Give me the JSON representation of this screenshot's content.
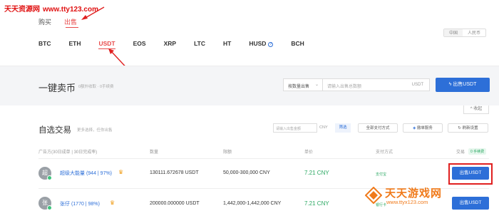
{
  "watermark": {
    "site_name": "天天资源网",
    "url": "www.tty123.com"
  },
  "trade_tabs": [
    {
      "label": "购买",
      "active": false
    },
    {
      "label": "出售",
      "active": true
    }
  ],
  "currency_toggle": [
    {
      "label": "中国",
      "active": true
    },
    {
      "label": "人民币",
      "active": false
    }
  ],
  "coins": [
    {
      "label": "BTC",
      "active": false
    },
    {
      "label": "ETH",
      "active": false
    },
    {
      "label": "USDT",
      "active": true
    },
    {
      "label": "EOS",
      "active": false
    },
    {
      "label": "XRP",
      "active": false
    },
    {
      "label": "LTC",
      "active": false
    },
    {
      "label": "HT",
      "active": false
    },
    {
      "label": "HUSD",
      "active": false,
      "has_info_icon": true
    },
    {
      "label": "BCH",
      "active": false
    }
  ],
  "quick_sell": {
    "title": "一键卖币",
    "subtitle": "0额外收取 · 0手续费",
    "select_value": "按数量出售",
    "input_placeholder": "请输入出售总数额",
    "input_unit": "USDT",
    "button_label": "出售USDT"
  },
  "collapse_label": "收起",
  "custom_trade": {
    "title": "自选交易",
    "subtitle": "更多选择，任你出售",
    "amount_placeholder": "请输入出售金额",
    "amount_unit": "CNY",
    "filter_label": "筛选",
    "payment_button": "全部支付方式",
    "ban_button": "撤单服务",
    "refresh_button": "刷新设置"
  },
  "table": {
    "headers": {
      "advertiser": "广告方(30日成单 | 30日完成率)",
      "quantity": "数量",
      "limit": "限额",
      "price": "单价",
      "payment": "支付方式",
      "action": "交易",
      "fee_badge": "0 手续费"
    },
    "rows": [
      {
        "avatar_initial": "超",
        "name": "超级大能量",
        "stats": "(944 | 97%)",
        "quantity": "130111.672678 USDT",
        "limit": "50,000-300,000 CNY",
        "price": "7.21 CNY",
        "payment": "支付宝",
        "action": "出售USDT"
      },
      {
        "avatar_initial": "张",
        "name": "张仔",
        "stats": "(1770 | 98%)",
        "quantity": "200000.000000 USDT",
        "limit": "1,442,000-1,442,000 CNY",
        "price": "7.21 CNY",
        "payment": "银行卡",
        "action": "出售USDT"
      }
    ]
  },
  "brand": {
    "name": "天天游戏网",
    "url": "www.ttyx123.com"
  },
  "colors": {
    "accent": "#2d6fd8",
    "sell_red": "#e84a4a",
    "price_green": "#2aa862",
    "annotation_red": "#e02020",
    "brand_orange": "#f07a1a"
  }
}
